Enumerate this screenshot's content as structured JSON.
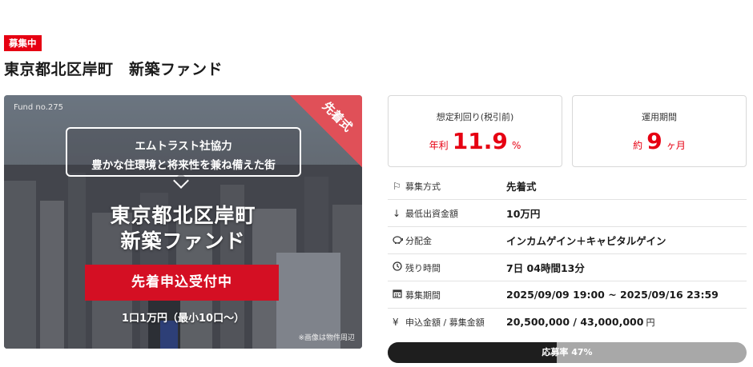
{
  "status_badge": "募集中",
  "title": "東京都北区岸町　新築ファンド",
  "hero": {
    "fund_no": "Fund no.275",
    "corner_label": "先着式",
    "bubble_line1": "エムトラスト社協力",
    "bubble_line2": "豊かな住環境と将来性を兼ね備えた街",
    "headline1": "東京都北区岸町",
    "headline2": "新築ファンド",
    "banner": "先着申込受付中",
    "unit_text": "1口1万円（最小10口〜）",
    "image_note": "※画像は物件周辺"
  },
  "yield": {
    "label": "想定利回り(税引前)",
    "prefix": "年利",
    "value": "11.9",
    "suffix": "%"
  },
  "term": {
    "label": "運用期間",
    "prefix": "約",
    "value": "9",
    "suffix": "ヶ月"
  },
  "details": [
    {
      "icon": "flag-icon",
      "key": "募集方式",
      "value": "先着式"
    },
    {
      "icon": "arrow-down-icon",
      "key": "最低出資金額",
      "value": "10万円"
    },
    {
      "icon": "piggy-bank-icon",
      "key": "分配金",
      "value": "インカムゲイン＋キャピタルゲイン"
    },
    {
      "icon": "clock-icon",
      "key": "残り時間",
      "value": "7日 04時間13分"
    },
    {
      "icon": "calendar-icon",
      "key": "募集期間",
      "value": "2025/09/09 19:00 ~ 2025/09/16 23:59"
    },
    {
      "icon": "yen-icon",
      "key": "申込金額 / 募集金額",
      "value": "20,500,000 / 43,000,000",
      "unit": "円"
    }
  ],
  "progress": {
    "label": "応募率 47%",
    "fraction": 0.47
  },
  "colors": {
    "accent": "#e60012",
    "banner": "#d40f23",
    "corner": "#e05058",
    "progress_fill": "#1e1e1e",
    "progress_track": "#a8a8a8"
  }
}
